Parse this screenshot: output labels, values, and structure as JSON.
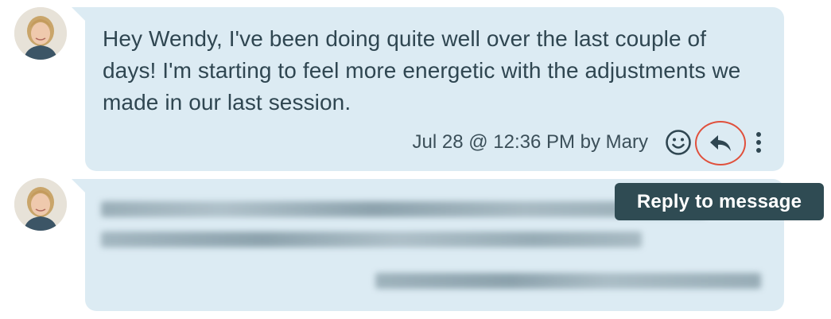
{
  "messages": [
    {
      "text": "Hey Wendy, I've been doing quite well over the last couple of days! I'm starting to feel more energetic with the adjustments we made in our last session.",
      "meta": "Jul 28 @ 12:36 PM by Mary"
    }
  ],
  "icons": {
    "reaction": "smiley-icon",
    "reply": "reply-arrow-icon",
    "more": "vertical-ellipsis-icon"
  },
  "tooltip": {
    "text": "Reply to message"
  },
  "colors": {
    "bubble": "#dcebf3",
    "text": "#2f4651",
    "tooltip_bg": "#2f4b53",
    "highlight_ring": "#e0503c"
  }
}
